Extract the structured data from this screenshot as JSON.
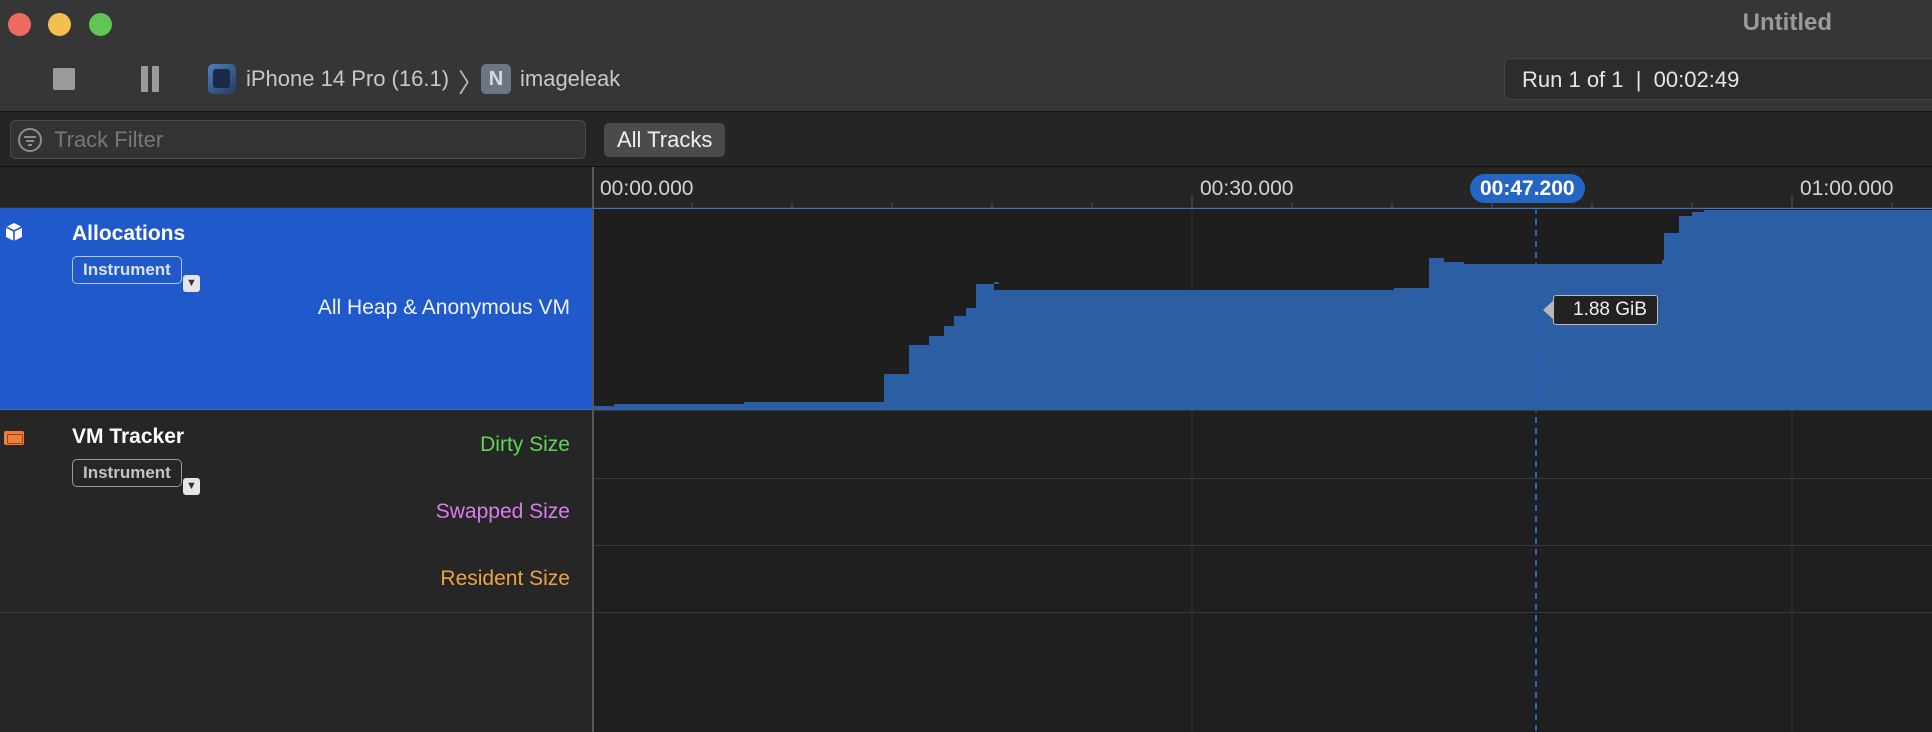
{
  "window": {
    "title": "Untitled"
  },
  "toolbar": {
    "device": "iPhone 14 Pro (16.1)",
    "app_icon_letter": "N",
    "app": "imageleak",
    "run_status": "Run 1 of 1  |  00:02:49"
  },
  "filter": {
    "placeholder": "Track Filter",
    "scope_button": "All Tracks"
  },
  "timeline": {
    "tick_labels": [
      "00:00.000",
      "00:30.000",
      "01:00.000"
    ],
    "playhead": "00:47.200"
  },
  "tracks": [
    {
      "name": "Allocations",
      "kind": "Instrument",
      "selected": true,
      "series": [
        {
          "name": "All Heap & Anonymous VM",
          "value_at_playhead": "1.88 GiB"
        }
      ]
    },
    {
      "name": "VM Tracker",
      "kind": "Instrument",
      "selected": false,
      "series": [
        {
          "name": "Dirty Size",
          "color": "#62d555"
        },
        {
          "name": "Swapped Size",
          "color": "#d97cf0"
        },
        {
          "name": "Resident Size",
          "color": "#eea43e"
        }
      ]
    }
  ],
  "colors": {
    "selection": "#2059c9",
    "graph_fill": "#2b5ea2",
    "playhead": "#2566c4"
  }
}
